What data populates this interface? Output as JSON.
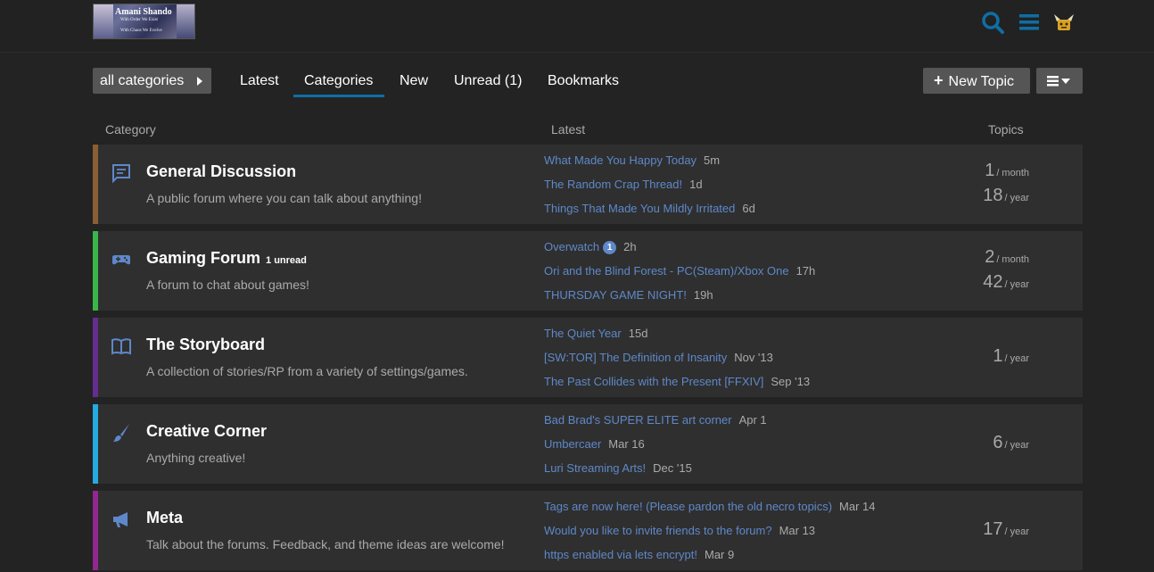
{
  "header": {
    "logo": {
      "line1": "Amani Shando",
      "line2": "With Order We Exist",
      "line3": "With Chaos We Evolve"
    },
    "icons": [
      "search-icon",
      "hamburger-menu-icon",
      "user-avatar-icon"
    ],
    "accent_color": "#0d6fa5"
  },
  "nav": {
    "category_dropdown": "all categories",
    "tabs": [
      "Latest",
      "Categories",
      "New",
      "Unread (1)",
      "Bookmarks"
    ],
    "active_tab": "Categories",
    "new_topic_label": "New Topic"
  },
  "table": {
    "headers": {
      "category": "Category",
      "latest": "Latest",
      "topics": "Topics"
    }
  },
  "categories": [
    {
      "name": "General Discussion",
      "description": "A public forum where you can talk about anything!",
      "color": "#8b5e34",
      "icon": "chat-bubble-icon",
      "unread": "",
      "topics": [
        {
          "title": "What Made You Happy Today",
          "age": "5m"
        },
        {
          "title": "The Random Crap Thread!",
          "age": "1d"
        },
        {
          "title": "Things That Made You Mildly Irritated",
          "age": "6d"
        }
      ],
      "stats": [
        {
          "n": "1",
          "u": "/ month"
        },
        {
          "n": "18",
          "u": "/ year"
        }
      ]
    },
    {
      "name": "Gaming Forum",
      "description": "A forum to chat about games!",
      "color": "#3ab54a",
      "icon": "gamepad-icon",
      "unread": "1 unread",
      "topics": [
        {
          "title": "Overwatch",
          "badge": "1",
          "age": "2h"
        },
        {
          "title": "Ori and the Blind Forest - PC(Steam)/Xbox One",
          "age": "17h"
        },
        {
          "title": "THURSDAY GAME NIGHT!",
          "age": "19h"
        }
      ],
      "stats": [
        {
          "n": "2",
          "u": "/ month"
        },
        {
          "n": "42",
          "u": "/ year"
        }
      ]
    },
    {
      "name": "The Storyboard",
      "description": "A collection of stories/RP from a variety of settings/games.",
      "color": "#652d90",
      "icon": "open-book-icon",
      "unread": "",
      "topics": [
        {
          "title": "The Quiet Year",
          "age": "15d"
        },
        {
          "title": "[SW:TOR] The Definition of Insanity",
          "age": "Nov '13"
        },
        {
          "title": "The Past Collides with the Present [FFXIV]",
          "age": "Sep '13"
        }
      ],
      "stats": [
        {
          "n": "1",
          "u": "/ year"
        }
      ]
    },
    {
      "name": "Creative Corner",
      "description": "Anything creative!",
      "color": "#25aae1",
      "icon": "paintbrush-icon",
      "unread": "",
      "topics": [
        {
          "title": "Bad Brad's SUPER ELITE art corner",
          "age": "Apr 1"
        },
        {
          "title": "Umbercaer",
          "age": "Mar 16"
        },
        {
          "title": "Luri Streaming Arts!",
          "age": "Dec '15"
        }
      ],
      "stats": [
        {
          "n": "6",
          "u": "/ year"
        }
      ]
    },
    {
      "name": "Meta",
      "description": "Talk about the forums. Feedback, and theme ideas are welcome!",
      "color": "#92278f",
      "icon": "megaphone-icon",
      "unread": "",
      "topics": [
        {
          "title": "Tags are now here! (Please pardon the old necro topics)",
          "age": "Mar 14"
        },
        {
          "title": "Would you like to invite friends to the forum?",
          "age": "Mar 13"
        },
        {
          "title": "https enabled via lets encrypt!",
          "age": "Mar 9"
        }
      ],
      "stats": [
        {
          "n": "17",
          "u": "/ year"
        }
      ]
    }
  ]
}
